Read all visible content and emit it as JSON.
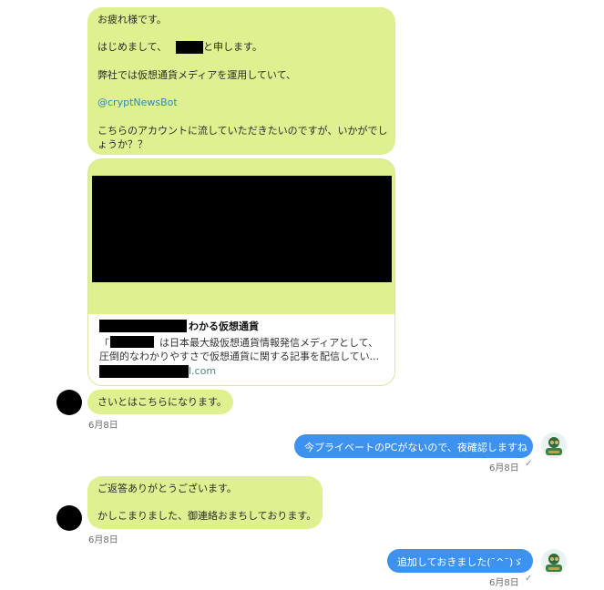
{
  "messages": {
    "m1": {
      "greeting": "お疲れ様です。",
      "intro_before": "はじめまして、",
      "intro_after": "と申します。",
      "media_line": "弊社では仮想通貨メディアを運用していて、",
      "mention": "@cryptNewsBot",
      "request": "こちらのアカウントに流していただきたいのですが、いかがでし",
      "request2": "ょうか？？"
    },
    "card": {
      "title_suffix": "わかる仮想通貨",
      "desc_open": "「",
      "desc_line1": "は日本最大級仮想通貨情報発信メディアとして、",
      "desc_line2": "圧倒的なわかりやすさで仮想通貨に関する記事を配信してい...",
      "domain_suffix": "l.com"
    },
    "m2": {
      "text": "さいとはこちらになります。",
      "date": "6月8日"
    },
    "m3": {
      "text": "今プライベートのPCがないので、夜確認しますね",
      "date": "6月8日",
      "status": "✓"
    },
    "m4": {
      "line1": "ご返答ありがとうございます。",
      "line2": "かしこまりました、御連絡おまちしております。",
      "date": "6月8日"
    },
    "m5": {
      "text": "追加しておきました(¯^¯)ゞ",
      "date": "6月8日",
      "status": "✓"
    }
  },
  "colors": {
    "incoming_bubble": "#def08f",
    "outgoing_bubble": "#3d92f0",
    "mention": "#2a8ab8"
  },
  "icons": {
    "user_avatar": "avatar-icon",
    "redacted_avatar": "redacted-avatar"
  }
}
